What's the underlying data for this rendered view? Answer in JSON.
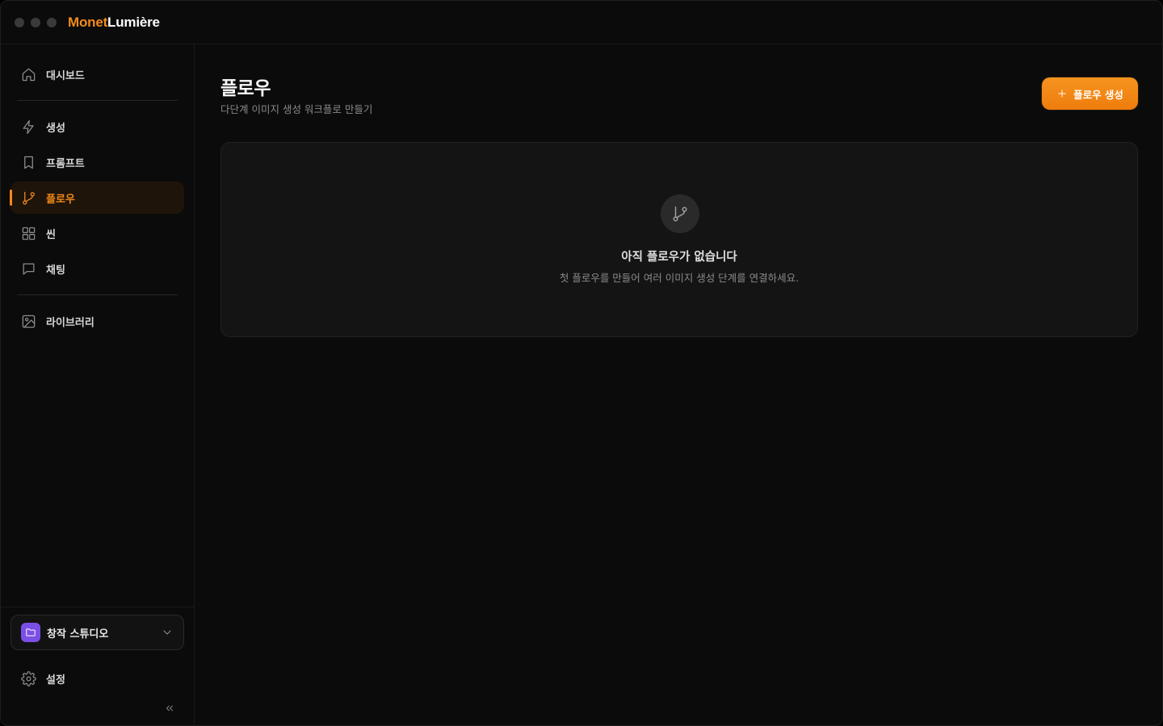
{
  "app": {
    "brand_part1": "Monet",
    "brand_part2": "Lumière",
    "accent_color": "#f28a1a"
  },
  "sidebar": {
    "items": [
      {
        "label": "대시보드",
        "icon": "home-icon"
      },
      {
        "label": "생성",
        "icon": "lightning-icon"
      },
      {
        "label": "프롬프트",
        "icon": "bookmark-icon"
      },
      {
        "label": "플로우",
        "icon": "git-branch-icon",
        "active": true
      },
      {
        "label": "씬",
        "icon": "grid-icon"
      },
      {
        "label": "채팅",
        "icon": "chat-icon"
      },
      {
        "label": "라이브러리",
        "icon": "image-icon"
      }
    ],
    "workspace": {
      "label": "창작 스튜디오",
      "icon": "folder-icon"
    },
    "settings_label": "설정",
    "collapse_icon": "chevrons-left-icon"
  },
  "main": {
    "title": "플로우",
    "subtitle": "다단계 이미지 생성 워크플로 만들기",
    "create_button_label": "플로우 생성",
    "empty_state": {
      "icon": "git-branch-icon",
      "title": "아직 플로우가 없습니다",
      "description": "첫 플로우를 만들어 여러 이미지 생성 단계를 연결하세요."
    }
  }
}
